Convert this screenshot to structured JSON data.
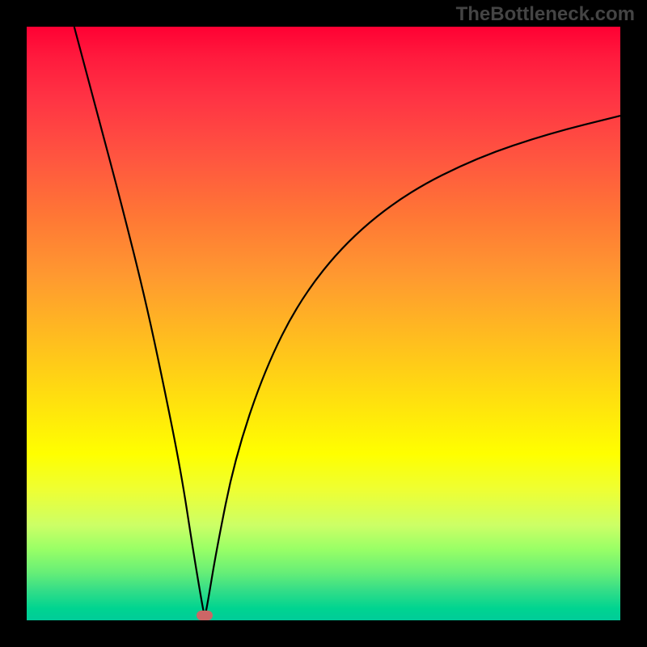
{
  "watermark": "TheBottleneck.com",
  "chart_data": {
    "type": "line",
    "title": "",
    "xlabel": "",
    "ylabel": "",
    "x_range": [
      0,
      100
    ],
    "y_range": [
      0,
      100
    ],
    "curve": {
      "description": "V-shaped bottleneck curve with minimum near x=30",
      "points": [
        {
          "x": 8,
          "y": 100
        },
        {
          "x": 12,
          "y": 85
        },
        {
          "x": 16,
          "y": 70
        },
        {
          "x": 20,
          "y": 54
        },
        {
          "x": 23,
          "y": 40
        },
        {
          "x": 26,
          "y": 25
        },
        {
          "x": 28,
          "y": 12
        },
        {
          "x": 29.5,
          "y": 3
        },
        {
          "x": 30,
          "y": 0.5
        },
        {
          "x": 30.5,
          "y": 3
        },
        {
          "x": 32,
          "y": 12
        },
        {
          "x": 35,
          "y": 27
        },
        {
          "x": 40,
          "y": 42
        },
        {
          "x": 46,
          "y": 54
        },
        {
          "x": 54,
          "y": 64
        },
        {
          "x": 64,
          "y": 72
        },
        {
          "x": 76,
          "y": 78
        },
        {
          "x": 88,
          "y": 82
        },
        {
          "x": 100,
          "y": 85
        }
      ]
    },
    "marker": {
      "x": 30,
      "y": 0.8,
      "color": "#cc6666"
    },
    "gradient_colors": {
      "top": "#ff0033",
      "middle": "#ffff00",
      "bottom": "#00cc99"
    }
  }
}
